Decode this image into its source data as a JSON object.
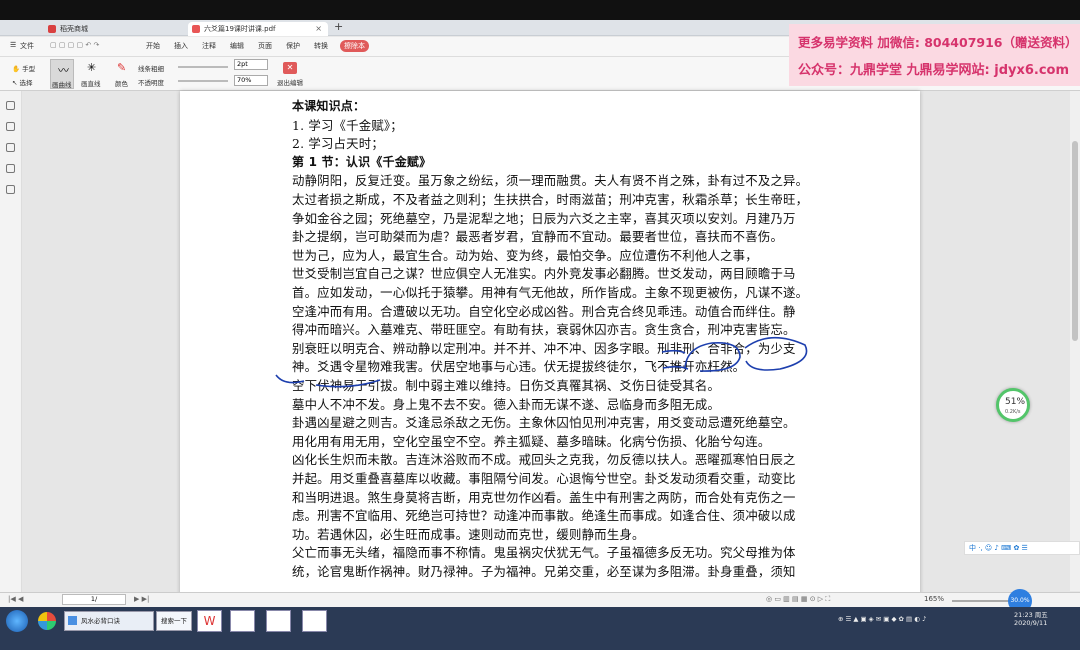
{
  "tabs": [
    {
      "label": "稻壳商城",
      "color": "#d94141"
    },
    {
      "label": "六爻篇19课时讲课.pdf",
      "color": "#e85656"
    }
  ],
  "menu": [
    "文件",
    "开始",
    "插入",
    "注释",
    "编辑",
    "页面",
    "保护",
    "转换",
    "擦除本"
  ],
  "toolbar": {
    "hand": "手型",
    "select": "选择",
    "pen_label": "画曲线",
    "highlight_label": "画直线",
    "color_label": "颜色",
    "line_thickness_label": "线条粗细",
    "opacity_label": "不透明度",
    "thickness_value": "2pt",
    "opacity_value": "70%",
    "exit_label": "退出编辑"
  },
  "watermark": {
    "line1": "更多易学资料 加微信: 804407916（赠送资料）",
    "line2": "公众号：九鼎学堂 九鼎易学网站: jdyx6.com"
  },
  "doc": {
    "lines": [
      {
        "text": "本课知识点：",
        "bold": true
      },
      {
        "text": "1.  学习《千金赋》；",
        "bold": false
      },
      {
        "text": "2.  学习占天时；",
        "bold": false
      },
      {
        "text": "第 1 节：认识《千金赋》",
        "bold": true
      },
      {
        "text": "动静阴阳，反复迁变。虽万象之纷纭，须一理而融贯。夫人有贤不肖之殊，卦有过不及之异。",
        "bold": false
      },
      {
        "text": "太过者损之斯成，不及者益之则利；生扶拱合，时雨滋苗；刑冲克害，秋霜杀草；长生帝旺，",
        "bold": false
      },
      {
        "text": "争如金谷之园；死绝墓空，乃是泥犁之地；日辰为六爻之主宰，喜其灭项以安刘。月建乃万",
        "bold": false
      },
      {
        "text": "卦之提纲，岂可助桀而为虐？最恶者岁君，宜静而不宜动。最要者世位，喜扶而不喜伤。",
        "bold": false
      },
      {
        "text": "世为己，应为人，最宜生合。动为始、变为终，最怕交争。应位遭伤不利他人之事，",
        "bold": false
      },
      {
        "text": "世爻受制岂宜自己之谋？世应俱空人无准实。内外竞发事必翻腾。世爻发动，两目顾瞻于马",
        "bold": false
      },
      {
        "text": "首。应如发动，一心似托于猿攀。用神有气无他故，所作皆成。主象不现更被伤，凡谋不遂。",
        "bold": false
      },
      {
        "text": "空逢冲而有用。合遭破以无功。自空化空必成凶咎。刑合克合终见乖违。动值合而绊住。静",
        "bold": false
      },
      {
        "text": "得冲而暗兴。入墓难克、带旺匪空。有助有扶，衰弱休囚亦吉。贪生贪合，刑冲克害皆忘。",
        "bold": false
      },
      {
        "text": "别衰旺以明克合、辨动静以定刑冲。并不并、冲不冲、因多字眼。刑非刑、合非合，为少支",
        "bold": false
      },
      {
        "text": "神。爻遇令星物难我害。伏居空地事与心违。伏无提拔终徒尔，飞不推开亦枉然。",
        "bold": false
      },
      {
        "text": "空下伏神易于引拔。制中弱主难以维持。日伤爻真罹其祸、爻伤日徒受其名。",
        "bold": false
      },
      {
        "text": "墓中人不冲不发。身上鬼不去不安。德入卦而无谋不遂、忌临身而多阻无成。",
        "bold": false
      },
      {
        "text": "卦遇凶星避之则吉。爻逢忌杀敌之无伤。主象休囚怕见刑冲克害，用爻变动忌遭死绝墓空。",
        "bold": false
      },
      {
        "text": "用化用有用无用，空化空虽空不空。养主狐疑、墓多暗昧。化病兮伤损、化胎兮勾连。",
        "bold": false
      },
      {
        "text": "凶化长生炽而未散。吉连沐浴败而不成。戒回头之克我，勿反德以扶人。恶曜孤寒怕日辰之",
        "bold": false
      },
      {
        "text": "并起。用爻重叠喜墓库以收藏。事阻隔兮间发。心退悔兮世空。卦爻发动须看交重，动变比",
        "bold": false
      },
      {
        "text": "和当明进退。煞生身莫将吉断，用克世勿作凶看。盖生中有刑害之两防，而合处有克伤之一",
        "bold": false
      },
      {
        "text": "虑。刑害不宜临用、死绝岂可持世？动逢冲而事散。绝逢生而事成。如逢合住、须冲破以成",
        "bold": false
      },
      {
        "text": "功。若遇休囚，必生旺而成事。速则动而克世，缓则静而生身。",
        "bold": false
      },
      {
        "text": "父亡而事无头绪，福隐而事不称情。鬼虽祸灾伏犹无气。子虽福德多反无功。究父母推为体",
        "bold": false
      },
      {
        "text": "统，论官鬼断作祸神。财乃禄神。子为福神。兄弟交重，必至谋为多阻滞。卦身重叠，须知",
        "bold": false
      }
    ]
  },
  "status": {
    "page": "1/",
    "zoom": "165%",
    "progress_percent": "51%",
    "speed": "0.2K/s",
    "blue_badge": "30.0%",
    "ime": "中 ·, ☺ ♪ ⌨ ✿ ☰",
    "time": "21:23 周五",
    "date": "2020/9/11"
  },
  "taskbar": {
    "btn1": "风水必背口诀",
    "btn2": "搜索一下"
  }
}
